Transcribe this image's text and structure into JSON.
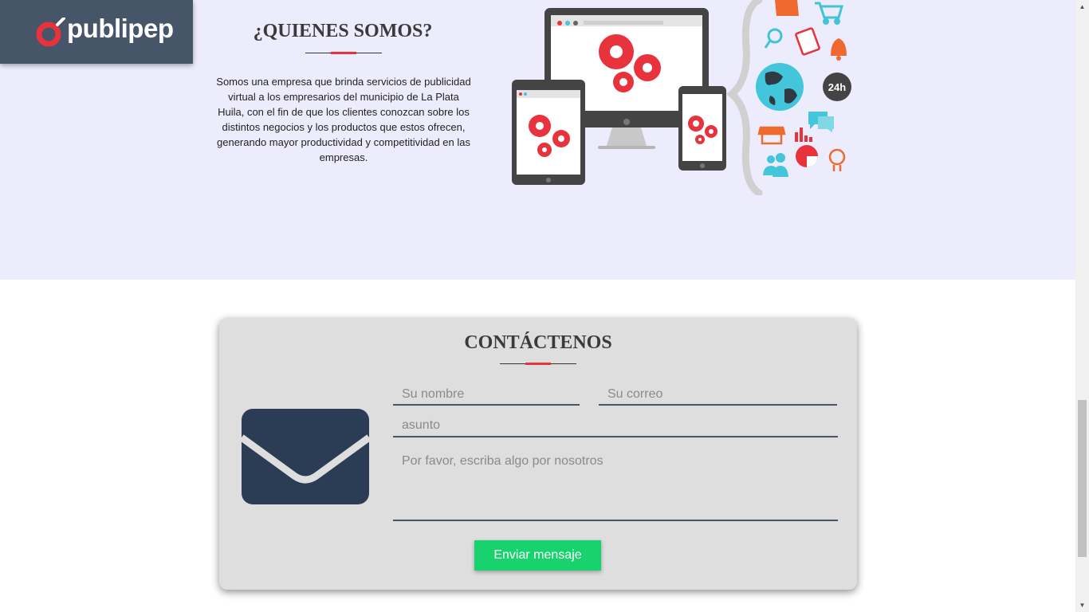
{
  "brand": {
    "name": "publipep"
  },
  "about": {
    "title": "¿QUIENES SOMOS?",
    "text": "Somos una empresa que brinda servicios de publicidad virtual a los empresarios del municipio de La Plata Huila, con el fin de que los clientes conozcan sobre los distintos negocios y los productos que estos ofrecen, generando mayor productividad y competitividad en las empresas.",
    "illustration_badge": "24h"
  },
  "contact": {
    "title": "CONTÁCTENOS",
    "name_placeholder": "Su nombre",
    "email_placeholder": "Su correo",
    "subject_placeholder": "asunto",
    "message_placeholder": "Por favor, escriba algo por nosotros",
    "submit_label": "Enviar mensaje"
  },
  "colors": {
    "about_background": "#edecfc",
    "logo_background": "#475569",
    "accent_red": "#e8323c",
    "card_background": "#dedede",
    "envelope": "#2b3d55",
    "button_green": "#18d26e"
  }
}
